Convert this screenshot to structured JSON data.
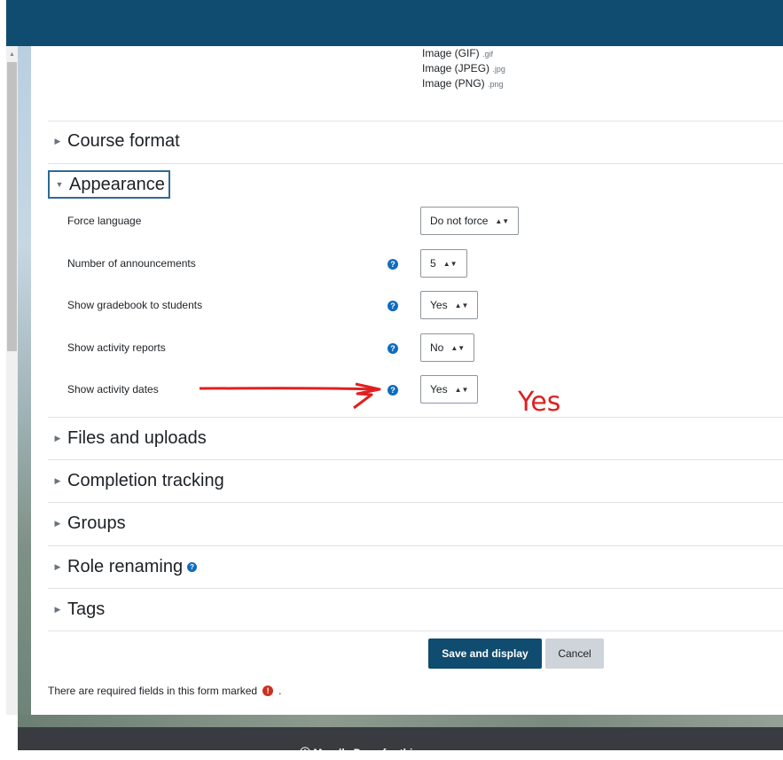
{
  "file_types": [
    {
      "name": "Image (GIF)",
      "ext": ".gif"
    },
    {
      "name": "Image (JPEG)",
      "ext": ".jpg"
    },
    {
      "name": "Image (PNG)",
      "ext": ".png"
    }
  ],
  "sections": {
    "course_format": "Course format",
    "appearance": "Appearance",
    "files_uploads": "Files and uploads",
    "completion": "Completion tracking",
    "groups": "Groups",
    "role_renaming": "Role renaming",
    "tags": "Tags"
  },
  "fields": {
    "force_language": {
      "label": "Force language",
      "value": "Do not force"
    },
    "announcements": {
      "label": "Number of announcements",
      "value": "5"
    },
    "gradebook": {
      "label": "Show gradebook to students",
      "value": "Yes"
    },
    "activity_reports": {
      "label": "Show activity reports",
      "value": "No"
    },
    "activity_dates": {
      "label": "Show activity dates",
      "value": "Yes"
    }
  },
  "annotation": {
    "text": "Yes",
    "color": "#e02020"
  },
  "buttons": {
    "save": "Save and display",
    "cancel": "Cancel"
  },
  "required_note": "There are required fields in this form marked",
  "required_note_suffix": ".",
  "footer": {
    "docs_link": "Moodle Docs for this page"
  },
  "colors": {
    "header": "#0f4c6f",
    "primary_button": "#0f4c6f",
    "help_icon": "#0f6cbf",
    "required_icon": "#ca3120"
  }
}
